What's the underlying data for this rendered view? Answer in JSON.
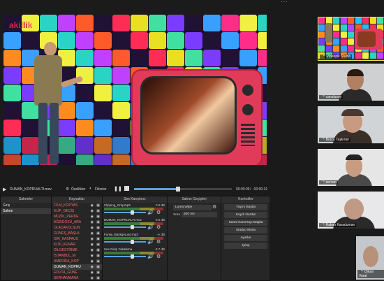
{
  "preview": {
    "logo_text": "akilli",
    "logo_accent": "k",
    "accent_color": "#e02040"
  },
  "transport": {
    "file_name": "DUMAN_KOPRUALTI.mov",
    "properties_label": "Özellikler",
    "filters_label": "Filtreler",
    "time_current": "00:00:09",
    "time_total": "-00:00:31"
  },
  "scenes": {
    "title": "Sahneler",
    "items": [
      "Giriş",
      "Sahne"
    ]
  },
  "sources": {
    "title": "Kaynaklar",
    "items": [
      "FİLM_KOPYAS",
      "KLİP_GEÇİŞ",
      "MÜZİK_PERDE",
      "AĞZIGÖZÜ_ARA",
      "OLACAKOLSUN",
      "GÜNEŞ_BAŞLA",
      "GİR_KASPAUS",
      "KLİP_KENAR",
      "DİLGESTİRME",
      "İSTANBUL_M",
      "AMERİKA_KOP",
      "DUMAN_KOPRU",
      "EDUTA_GÜNE",
      "SERHANMANA"
    ]
  },
  "mixer": {
    "title": "Ses Karıştırıcı",
    "channels": [
      {
        "name": "Clipping_Only.mp3",
        "db": "0.0 dB"
      },
      {
        "name": "DUMAN_KOPRUALTI.mov",
        "db": "0.0 dB"
      },
      {
        "name": "Funky_Background.mp3",
        "db": "-∞ dB"
      },
      {
        "name": "Ses Girişi Yakalama",
        "db": "-3.7 dB"
      }
    ]
  },
  "transitions": {
    "title": "Sahne Geçişleri",
    "type": "Luma Wipe",
    "duration_label": "Süre",
    "duration_value": "300 ms"
  },
  "controls": {
    "title": "Kontroller",
    "buttons": [
      "Yayını Başlat",
      "Kaydı Durdur",
      "Sanal Kamerayı Başlat",
      "Stüdyo Modu",
      "Ayarlar",
      "Çıkış"
    ]
  },
  "participants": [
    {
      "name": "Videopik Studio"
    },
    {
      "name": "canulusoy"
    },
    {
      "name": "Burcu Taşkıran"
    },
    {
      "name": "sercan"
    },
    {
      "name": "Hakan Karaduman"
    },
    {
      "name": "Orkan Vural"
    }
  ]
}
